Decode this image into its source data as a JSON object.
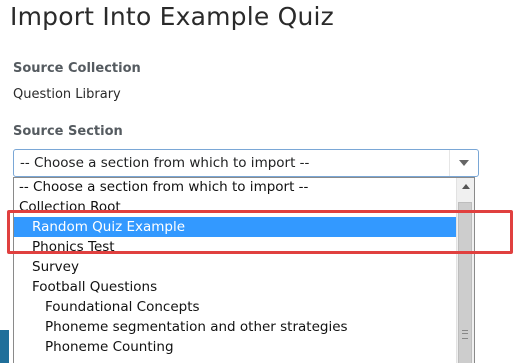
{
  "page": {
    "title": "Import Into Example Quiz"
  },
  "source_collection": {
    "label": "Source Collection",
    "value": "Question Library"
  },
  "source_section": {
    "label": "Source Section",
    "selected_value": "-- Choose a section from which to import --"
  },
  "dropdown": {
    "options": [
      {
        "label": "-- Choose a section from which to import --",
        "indent": 0,
        "selected": false
      },
      {
        "label": "Collection Root",
        "indent": 0,
        "selected": false
      },
      {
        "label": "Random Quiz Example",
        "indent": 1,
        "selected": true
      },
      {
        "label": "Phonics Test",
        "indent": 1,
        "selected": false
      },
      {
        "label": "Survey",
        "indent": 1,
        "selected": false
      },
      {
        "label": "Football Questions",
        "indent": 1,
        "selected": false
      },
      {
        "label": "Foundational Concepts",
        "indent": 2,
        "selected": false
      },
      {
        "label": "Phoneme segmentation and other strategies",
        "indent": 2,
        "selected": false
      },
      {
        "label": "Phoneme Counting",
        "indent": 2,
        "selected": false
      }
    ]
  },
  "colors": {
    "selected_option_bg": "#3399ff",
    "highlight_border": "#e0403f",
    "select_border": "#7aa7d6",
    "left_accent": "#1f6f9a"
  },
  "icons": {
    "select_arrow": "chevron-down-icon",
    "scroll_up": "scroll-up-arrow-icon",
    "thumb_grip": "scroll-grip-icon"
  }
}
